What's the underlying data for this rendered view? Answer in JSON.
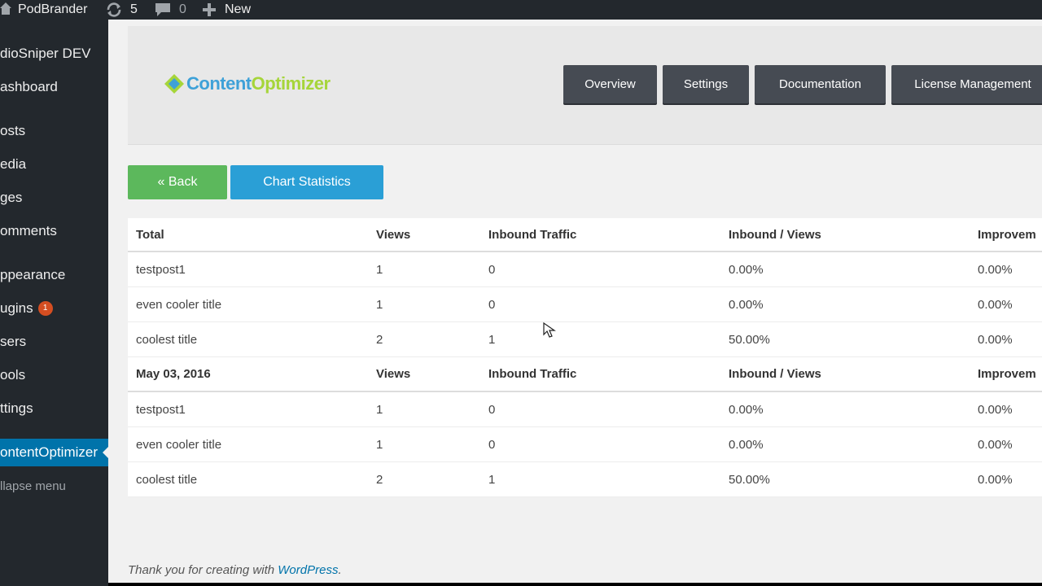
{
  "adminbar": {
    "site_name": "PodBrander",
    "updates_count": "5",
    "comments_count": "0",
    "new_label": "New"
  },
  "sidemenu": {
    "items": [
      {
        "label": "dioSniper DEV"
      },
      {
        "label": "ashboard"
      },
      {
        "label": "osts"
      },
      {
        "label": "edia"
      },
      {
        "label": "ges"
      },
      {
        "label": "omments"
      },
      {
        "label": "ppearance"
      },
      {
        "label": "ugins",
        "badge": "1"
      },
      {
        "label": "sers"
      },
      {
        "label": "ools"
      },
      {
        "label": "ttings"
      },
      {
        "label": "ontentOptimizer"
      },
      {
        "label": "llapse menu"
      }
    ]
  },
  "plugin": {
    "logo_part1": "Content",
    "logo_part2": "Optimizer",
    "nav": [
      "Overview",
      "Settings",
      "Documentation",
      "License Management"
    ]
  },
  "actions": {
    "back_label": "« Back",
    "chart_label": "Chart Statistics"
  },
  "table": {
    "groups": [
      {
        "header": [
          "Total",
          "Views",
          "Inbound Traffic",
          "Inbound / Views",
          "Improvem"
        ],
        "rows": [
          [
            "testpost1",
            "1",
            "0",
            "0.00%",
            "0.00%"
          ],
          [
            "even cooler title",
            "1",
            "0",
            "0.00%",
            "0.00%"
          ],
          [
            "coolest title",
            "2",
            "1",
            "50.00%",
            "0.00%"
          ]
        ]
      },
      {
        "header": [
          "May 03, 2016",
          "Views",
          "Inbound Traffic",
          "Inbound / Views",
          "Improvem"
        ],
        "rows": [
          [
            "testpost1",
            "1",
            "0",
            "0.00%",
            "0.00%"
          ],
          [
            "even cooler title",
            "1",
            "0",
            "0.00%",
            "0.00%"
          ],
          [
            "coolest title",
            "2",
            "1",
            "50.00%",
            "0.00%"
          ]
        ]
      }
    ]
  },
  "footer": {
    "text": "Thank you for creating with",
    "link": "WordPress",
    "suffix": "."
  },
  "colors": {
    "adminbar_bg": "#23282d",
    "current_menu": "#0073aa",
    "back_button": "#5cb85c",
    "chart_button": "#2a9fd6",
    "nav_button": "#464b53"
  }
}
